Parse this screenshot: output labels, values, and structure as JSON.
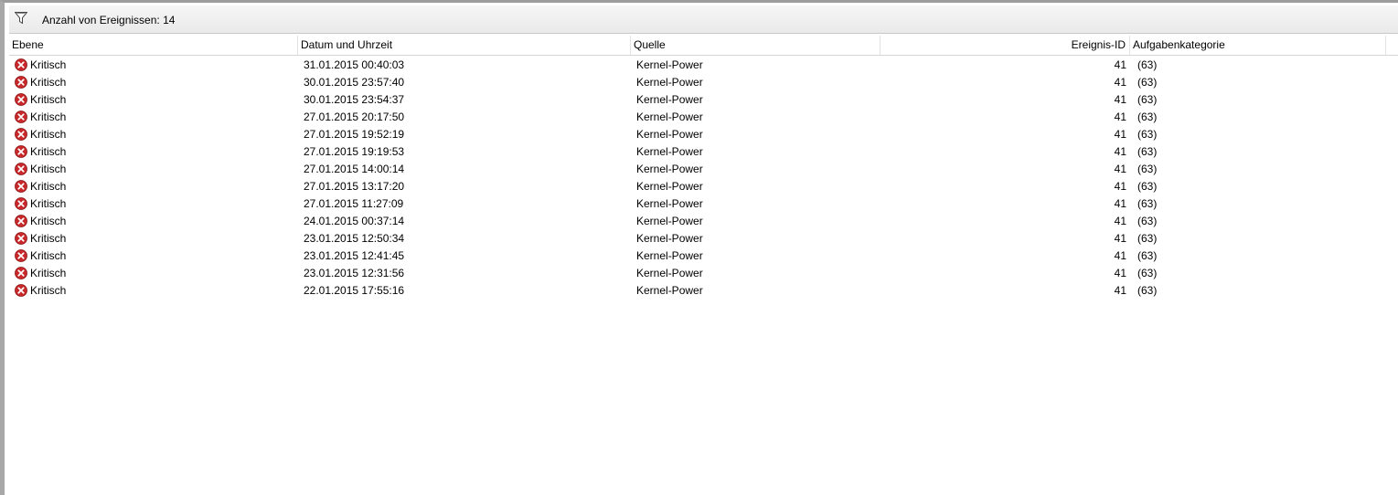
{
  "filter_bar": {
    "icon": "filter-icon",
    "count_text": "Anzahl von Ereignissen: 14"
  },
  "columns": {
    "level": "Ebene",
    "datetime": "Datum und Uhrzeit",
    "source": "Quelle",
    "event_id": "Ereignis-ID",
    "task_category": "Aufgabenkategorie"
  },
  "colors": {
    "error_icon": "#c8282a",
    "header_border": "#d5d5d5"
  },
  "events": [
    {
      "level": "Kritisch",
      "datetime": "31.01.2015 00:40:03",
      "source": "Kernel-Power",
      "event_id": "41",
      "task_category": "(63)"
    },
    {
      "level": "Kritisch",
      "datetime": "30.01.2015 23:57:40",
      "source": "Kernel-Power",
      "event_id": "41",
      "task_category": "(63)"
    },
    {
      "level": "Kritisch",
      "datetime": "30.01.2015 23:54:37",
      "source": "Kernel-Power",
      "event_id": "41",
      "task_category": "(63)"
    },
    {
      "level": "Kritisch",
      "datetime": "27.01.2015 20:17:50",
      "source": "Kernel-Power",
      "event_id": "41",
      "task_category": "(63)"
    },
    {
      "level": "Kritisch",
      "datetime": "27.01.2015 19:52:19",
      "source": "Kernel-Power",
      "event_id": "41",
      "task_category": "(63)"
    },
    {
      "level": "Kritisch",
      "datetime": "27.01.2015 19:19:53",
      "source": "Kernel-Power",
      "event_id": "41",
      "task_category": "(63)"
    },
    {
      "level": "Kritisch",
      "datetime": "27.01.2015 14:00:14",
      "source": "Kernel-Power",
      "event_id": "41",
      "task_category": "(63)"
    },
    {
      "level": "Kritisch",
      "datetime": "27.01.2015 13:17:20",
      "source": "Kernel-Power",
      "event_id": "41",
      "task_category": "(63)"
    },
    {
      "level": "Kritisch",
      "datetime": "27.01.2015 11:27:09",
      "source": "Kernel-Power",
      "event_id": "41",
      "task_category": "(63)"
    },
    {
      "level": "Kritisch",
      "datetime": "24.01.2015 00:37:14",
      "source": "Kernel-Power",
      "event_id": "41",
      "task_category": "(63)"
    },
    {
      "level": "Kritisch",
      "datetime": "23.01.2015 12:50:34",
      "source": "Kernel-Power",
      "event_id": "41",
      "task_category": "(63)"
    },
    {
      "level": "Kritisch",
      "datetime": "23.01.2015 12:41:45",
      "source": "Kernel-Power",
      "event_id": "41",
      "task_category": "(63)"
    },
    {
      "level": "Kritisch",
      "datetime": "23.01.2015 12:31:56",
      "source": "Kernel-Power",
      "event_id": "41",
      "task_category": "(63)"
    },
    {
      "level": "Kritisch",
      "datetime": "22.01.2015 17:55:16",
      "source": "Kernel-Power",
      "event_id": "41",
      "task_category": "(63)"
    }
  ]
}
